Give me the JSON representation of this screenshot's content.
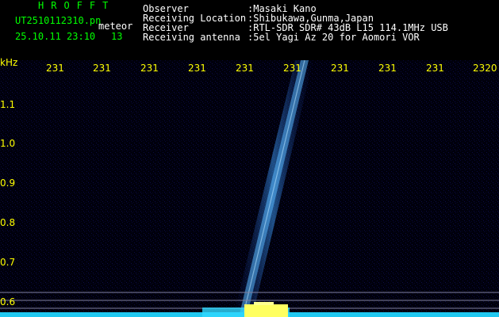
{
  "app": {
    "title": "HROFFT",
    "file_name": "UT2510112310.pn",
    "mode": "meteor",
    "date_time": "25.10.11 23:10",
    "count": "13"
  },
  "info": [
    {
      "label": "Observer",
      "value": ":Masaki Kano"
    },
    {
      "label": "Receiving Location",
      "value": ":Shibukawa,Gunma,Japan"
    },
    {
      "label": "Receiver",
      "value": ":RTL-SDR SDR# 43dB L15 114.1MHz USB"
    },
    {
      "label": "Receiving antenna",
      "value": ":5el Yagi Az 20 for Aomori VOR"
    }
  ],
  "plot": {
    "y_unit": "kHz",
    "y_ticks": [
      "1.1",
      "1.0",
      "0.9",
      "0.8",
      "0.7",
      "0.6"
    ],
    "x_ticks": [
      "231",
      "231",
      "231",
      "231",
      "231",
      "231",
      "231",
      "231",
      "231",
      "2320"
    ],
    "colors": {
      "background": "#000010",
      "trace": "#40a8ff",
      "baseline": "#20e0ff",
      "grid": "#8080a0"
    }
  }
}
